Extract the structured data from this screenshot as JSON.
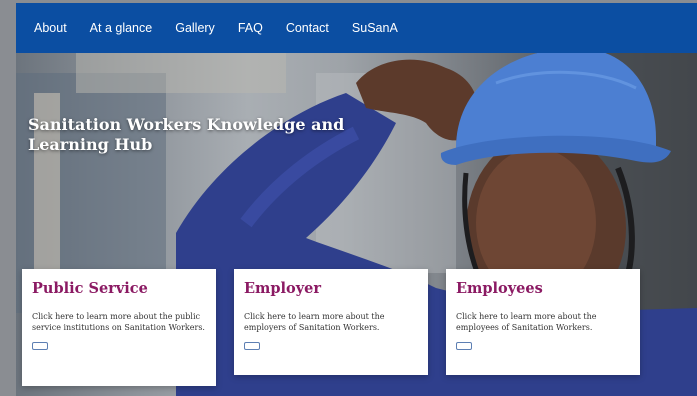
{
  "nav": {
    "items": [
      "About",
      "At a glance",
      "Gallery",
      "FAQ",
      "Contact",
      "SuSanA"
    ]
  },
  "hero": {
    "title": "Sanitation Workers Knowledge and Learning Hub"
  },
  "cards": [
    {
      "title": "Public Service",
      "text": "Click here to learn more about the public service institutions on Sanitation Workers."
    },
    {
      "title": "Employer",
      "text": "Click here to learn more about the employers of Sanitation Workers."
    },
    {
      "title": "Employees",
      "text": "Click here to learn more about the employees of Sanitation Workers."
    }
  ],
  "colors": {
    "nav_background": "#0b4ea2",
    "card_title": "#8b1a63",
    "button_border": "#5d7fb3"
  }
}
